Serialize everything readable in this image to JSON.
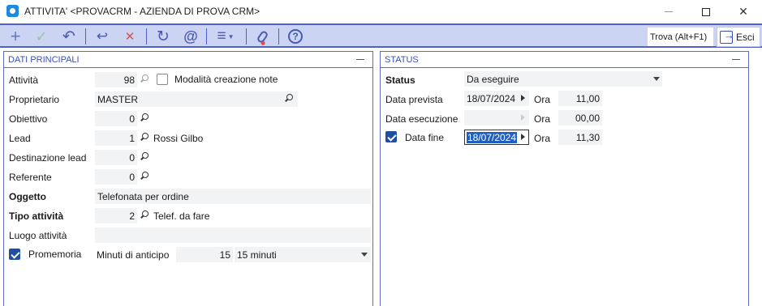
{
  "window": {
    "title": "ATTIVITA' <PROVACRM - AZIENDA DI PROVA CRM>"
  },
  "toolbar": {
    "buttons": [
      {
        "name": "add",
        "icon": "plus-icon",
        "glyph": "+"
      },
      {
        "name": "confirm",
        "icon": "check-icon",
        "glyph": "✓"
      },
      {
        "name": "undo",
        "icon": "undo-icon",
        "glyph": "↶"
      },
      {
        "name": "restore",
        "icon": "restore-icon",
        "glyph": "↩"
      },
      {
        "name": "delete",
        "icon": "delete-icon",
        "glyph": "✕"
      },
      {
        "name": "refresh",
        "icon": "refresh-icon",
        "glyph": "↻"
      },
      {
        "name": "email",
        "icon": "at-icon",
        "glyph": "@"
      },
      {
        "name": "menu",
        "icon": "menu-icon",
        "glyph": "≡"
      },
      {
        "name": "attach",
        "icon": "paperclip-icon",
        "glyph": "🖇"
      },
      {
        "name": "help",
        "icon": "help-icon",
        "glyph": "?"
      }
    ],
    "search_label": "Trova (Alt+F1)",
    "exit_label": "Esci"
  },
  "left_panel": {
    "header": "DATI PRINCIPALI",
    "attivita_label": "Attività",
    "attivita_value": "98",
    "modalita_label": "Modalità creazione note",
    "modalita_checked": false,
    "proprietario_label": "Proprietario",
    "proprietario_value": "MASTER",
    "obiettivo_label": "Obiettivo",
    "obiettivo_value": "0",
    "lead_label": "Lead",
    "lead_value": "1",
    "lead_desc": "Rossi Gilbo",
    "destinazione_label": "Destinazione lead",
    "destinazione_value": "0",
    "referente_label": "Referente",
    "referente_value": "0",
    "oggetto_label": "Oggetto",
    "oggetto_value": "Telefonata per ordine",
    "tipo_label": "Tipo attività",
    "tipo_value": "2",
    "tipo_desc": "Telef. da fare",
    "luogo_label": "Luogo attività",
    "luogo_value": "",
    "promemoria_label": "Promemoria",
    "promemoria_checked": true,
    "minuti_label": "Minuti di anticipo",
    "minuti_value": "15",
    "minuti_select": "15 minuti"
  },
  "right_panel": {
    "header": "STATUS",
    "status_label": "Status",
    "status_value": "Da eseguire",
    "data_prevista_label": "Data prevista",
    "data_prevista_value": "18/07/2024",
    "ora_label": "Ora",
    "ora_prevista_value": "11,00",
    "data_esecuzione_label": "Data esecuzione",
    "data_esecuzione_value": "",
    "ora_esecuzione_value": "00,00",
    "data_fine_label": "Data fine",
    "data_fine_checked": true,
    "data_fine_value": "18/07/2024",
    "ora_fine_value": "11,30"
  },
  "colors": {
    "toolbar_bg": "#ccd4f3",
    "accent": "#4f61c9",
    "header_text": "#3b4fb5",
    "field_bg": "#f1f3f5",
    "selection": "#1f5fbf"
  }
}
